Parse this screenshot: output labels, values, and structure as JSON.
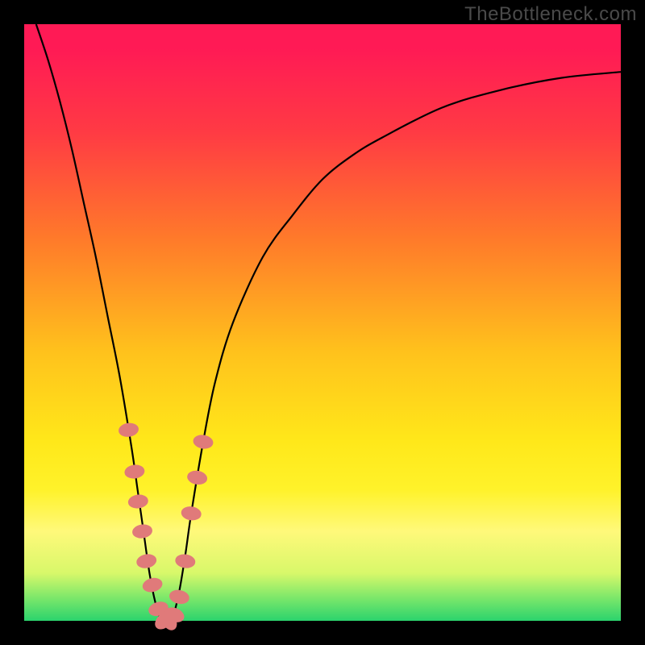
{
  "watermark": "TheBottleneck.com",
  "colors": {
    "bead": "#e07a7a",
    "curve": "#000000"
  },
  "chart_data": {
    "type": "line",
    "title": "",
    "xlabel": "",
    "ylabel": "",
    "xlim": [
      0,
      100
    ],
    "ylim": [
      0,
      100
    ],
    "curve": {
      "x": [
        2,
        4,
        6,
        8,
        10,
        12,
        14,
        16,
        18,
        19,
        20,
        21,
        22,
        23,
        24,
        25,
        26,
        27,
        28,
        30,
        32,
        35,
        40,
        45,
        50,
        55,
        60,
        70,
        80,
        90,
        100
      ],
      "y": [
        100,
        94,
        87,
        79,
        70,
        61,
        51,
        41,
        29,
        22,
        15,
        8,
        3,
        0,
        0,
        1,
        5,
        11,
        18,
        30,
        40,
        50,
        61,
        68,
        74,
        78,
        81,
        86,
        89,
        91,
        92
      ]
    },
    "beads": {
      "x": [
        17.5,
        18.5,
        19.1,
        19.8,
        20.5,
        21.5,
        22.5,
        23.4,
        24.3,
        25.2,
        26.0,
        27.0,
        28.0,
        29.0,
        30.0
      ],
      "y": [
        32,
        25,
        20,
        15,
        10,
        6,
        2,
        0,
        0,
        1,
        4,
        10,
        18,
        24,
        30
      ]
    }
  }
}
